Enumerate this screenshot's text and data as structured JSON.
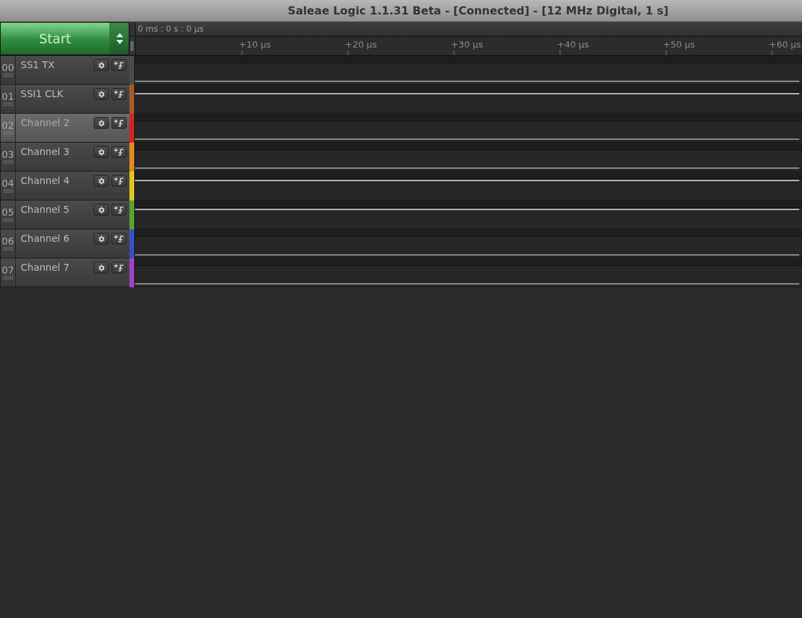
{
  "window": {
    "title": "Saleae Logic 1.1.31 Beta - [Connected] - [12 MHz Digital, 1 s]"
  },
  "start_button": {
    "label": "Start"
  },
  "timeline": {
    "cursor_time": "0 ms : 0 s : 0 µs",
    "ticks": [
      "+10 µs",
      "+20 µs",
      "+30 µs",
      "+40 µs",
      "+50 µs",
      "+60 µs"
    ]
  },
  "channels": [
    {
      "number": "00",
      "name": "SS1 TX",
      "color": "#4a4a4a",
      "high": false,
      "selected": false
    },
    {
      "number": "01",
      "name": "SSI1 CLK",
      "color": "#a85a2a",
      "high": true,
      "selected": false
    },
    {
      "number": "02",
      "name": "Channel 2",
      "color": "#d02424",
      "high": false,
      "selected": true
    },
    {
      "number": "03",
      "name": "Channel 3",
      "color": "#e08a1c",
      "high": false,
      "selected": false
    },
    {
      "number": "04",
      "name": "Channel 4",
      "color": "#e0c424",
      "high": true,
      "selected": false
    },
    {
      "number": "05",
      "name": "Channel 5",
      "color": "#5ea034",
      "high": true,
      "selected": false
    },
    {
      "number": "06",
      "name": "Channel 6",
      "color": "#3850c0",
      "high": false,
      "selected": false
    },
    {
      "number": "07",
      "name": "Channel 7",
      "color": "#9a44c4",
      "high": false,
      "selected": false
    }
  ]
}
